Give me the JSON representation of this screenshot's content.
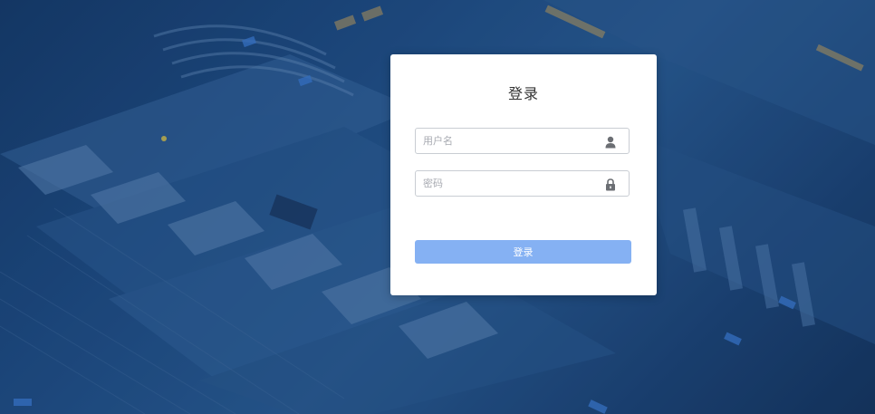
{
  "login": {
    "title": "登录",
    "username": {
      "placeholder": "用户名",
      "value": ""
    },
    "password": {
      "placeholder": "密码",
      "value": ""
    },
    "submit_label": "登录"
  },
  "icons": {
    "username": "user-icon",
    "password": "lock-icon"
  },
  "colors": {
    "button": "#85b1f3",
    "background": "#1f4c85"
  }
}
